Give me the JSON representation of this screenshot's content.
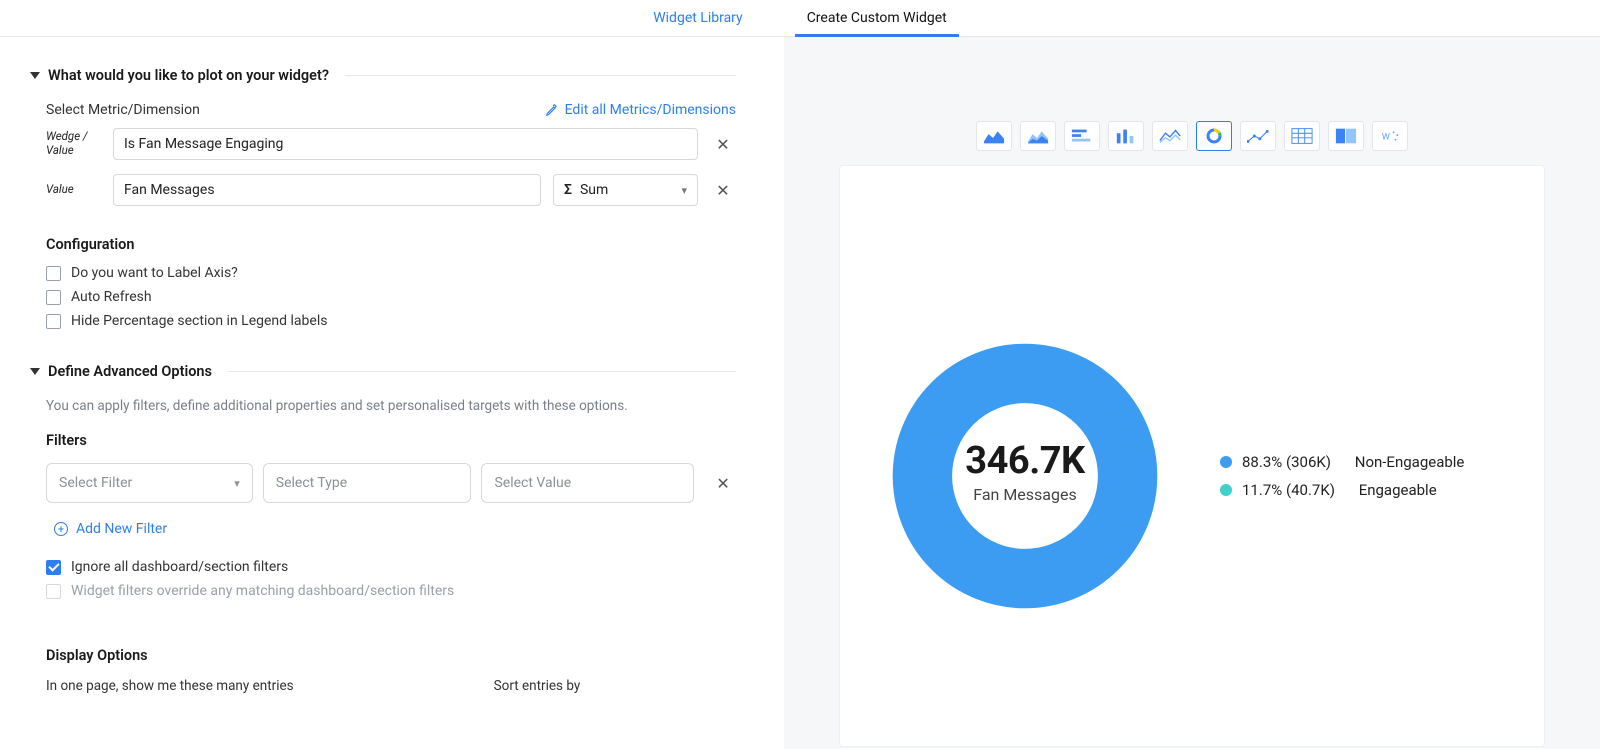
{
  "tabs": {
    "library": "Widget Library",
    "custom": "Create Custom Widget"
  },
  "plot": {
    "heading": "What would you like to plot on your widget?",
    "select_label": "Select Metric/Dimension",
    "edit_all": "Edit all Metrics/Dimensions",
    "wedge_label": "Wedge / Value",
    "wedge_value": "Is Fan Message Engaging",
    "value_label": "Value",
    "value_value": "Fan Messages",
    "agg": "Sum"
  },
  "config": {
    "heading": "Configuration",
    "label_axis": "Do you want to Label Axis?",
    "auto_refresh": "Auto Refresh",
    "hide_pct": "Hide Percentage section in Legend labels"
  },
  "advanced": {
    "heading": "Define Advanced Options",
    "sub": "You can apply filters, define additional properties and set personalised targets with these options.",
    "filters_heading": "Filters",
    "f1": "Select Filter",
    "f2": "Select Type",
    "f3": "Select Value",
    "add": "Add New Filter",
    "ignore": "Ignore all dashboard/section filters",
    "override": "Widget filters override any matching dashboard/section filters"
  },
  "display": {
    "heading": "Display Options",
    "entries": "In one page, show me these many entries",
    "sort": "Sort entries by"
  },
  "chart_data": {
    "type": "pie",
    "title": "Fan Messages",
    "total_label": "346.7K",
    "series": [
      {
        "name": "Non-Engageable",
        "pct": 88.3,
        "count_label": "306K",
        "color": "#3b9cf1"
      },
      {
        "name": "Engageable",
        "pct": 11.7,
        "count_label": "40.7K",
        "color": "#3fd0c9"
      }
    ]
  },
  "legend": {
    "item0": "88.3% (306K)",
    "name0": "Non-Engageable",
    "item1": "11.7% (40.7K)",
    "name1": "Engageable"
  }
}
